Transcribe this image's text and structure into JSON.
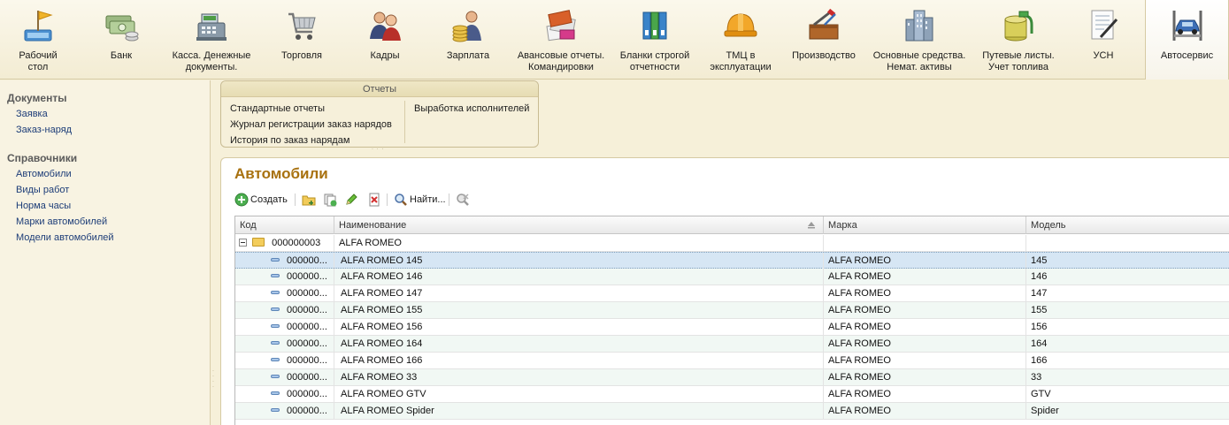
{
  "sections": [
    {
      "label": "Рабочий\nстол",
      "icon": "desktop-flag-icon"
    },
    {
      "label": "Банк",
      "icon": "money-stack-icon"
    },
    {
      "label": "Касса. Денежные\nдокументы.",
      "icon": "cash-register-icon"
    },
    {
      "label": "Торговля",
      "icon": "shopping-cart-icon"
    },
    {
      "label": "Кадры",
      "icon": "people-icon"
    },
    {
      "label": "Зарплата",
      "icon": "coins-person-icon"
    },
    {
      "label": "Авансовые отчеты.\nКомандировки",
      "icon": "documents-stack-icon"
    },
    {
      "label": "Бланки строгой\nотчетности",
      "icon": "binders-icon"
    },
    {
      "label": "ТМЦ в\nэксплуатации",
      "icon": "hard-hat-icon"
    },
    {
      "label": "Производство",
      "icon": "toolbox-icon"
    },
    {
      "label": "Основные средства.\nНемат. активы",
      "icon": "buildings-icon"
    },
    {
      "label": "Путевые листы.\nУчет топлива",
      "icon": "fuel-pump-icon"
    },
    {
      "label": "УСН",
      "icon": "document-pen-icon"
    },
    {
      "label": "Автосервис",
      "icon": "car-lift-icon"
    }
  ],
  "left_panel": {
    "documents_title": "Документы",
    "documents": [
      "Заявка",
      "Заказ-наряд"
    ],
    "catalogs_title": "Справочники",
    "catalogs": [
      "Автомобили",
      "Виды работ",
      "Норма часы",
      "Марки автомобилей",
      "Модели автомобилей"
    ]
  },
  "reports": {
    "title": "Отчеты",
    "col1": [
      "Стандартные отчеты",
      "Журнал регистрации заказ нарядов",
      "История по заказ нарядам"
    ],
    "col2": [
      "Выработка исполнителей"
    ]
  },
  "main": {
    "title": "Автомобили",
    "toolbar": {
      "create_label": "Создать",
      "find_label": "Найти..."
    },
    "columns": [
      "Код",
      "Наименование",
      "Марка",
      "Модель"
    ],
    "group_row": {
      "kod": "000000003",
      "name": "ALFA ROMEO"
    },
    "rows": [
      {
        "kod": "000000...",
        "name": "ALFA ROMEO 145",
        "marka": "ALFA ROMEO",
        "model": "145"
      },
      {
        "kod": "000000...",
        "name": "ALFA ROMEO 146",
        "marka": "ALFA ROMEO",
        "model": "146"
      },
      {
        "kod": "000000...",
        "name": "ALFA ROMEO 147",
        "marka": "ALFA ROMEO",
        "model": "147"
      },
      {
        "kod": "000000...",
        "name": "ALFA ROMEO 155",
        "marka": "ALFA ROMEO",
        "model": "155"
      },
      {
        "kod": "000000...",
        "name": "ALFA ROMEO 156",
        "marka": "ALFA ROMEO",
        "model": "156"
      },
      {
        "kod": "000000...",
        "name": "ALFA ROMEO 164",
        "marka": "ALFA ROMEO",
        "model": "164"
      },
      {
        "kod": "000000...",
        "name": "ALFA ROMEO 166",
        "marka": "ALFA ROMEO",
        "model": "166"
      },
      {
        "kod": "000000...",
        "name": "ALFA ROMEO 33",
        "marka": "ALFA ROMEO",
        "model": "33"
      },
      {
        "kod": "000000...",
        "name": "ALFA ROMEO GTV",
        "marka": "ALFA ROMEO",
        "model": "GTV"
      },
      {
        "kod": "000000...",
        "name": "ALFA ROMEO Spider",
        "marka": "ALFA ROMEO",
        "model": "Spider"
      }
    ]
  }
}
